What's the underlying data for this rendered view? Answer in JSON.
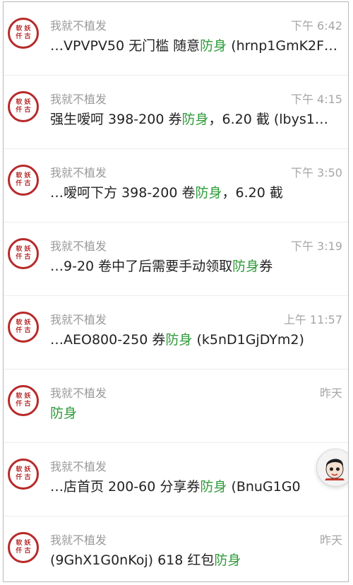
{
  "list": [
    {
      "sender": "我就不植发",
      "time": "下午 6:42",
      "pre": "…VPVPV50 无门槛 随意",
      "hl": "防身",
      "post": " (hrnp1GmK2F…"
    },
    {
      "sender": "我就不植发",
      "time": "下午 4:15",
      "pre": "强生嗳呵 398-200 券",
      "hl": "防身",
      "post": "，6.20 截  (lbys1…"
    },
    {
      "sender": "我就不植发",
      "time": "下午 3:50",
      "pre": "…嗳呵下方 398-200 卷",
      "hl": "防身",
      "post": "，6.20 截"
    },
    {
      "sender": "我就不植发",
      "time": "下午 3:19",
      "pre": "…9-20 卷中了后需要手动领取",
      "hl": "防身",
      "post": "券"
    },
    {
      "sender": "我就不植发",
      "time": "上午 11:57",
      "pre": "…AEO800-250 券",
      "hl": "防身",
      "post": "  (k5nD1GjDYm2)"
    },
    {
      "sender": "我就不植发",
      "time": "昨天",
      "pre": "",
      "hl": "防身",
      "post": ""
    },
    {
      "sender": "我就不植发",
      "time": "",
      "pre": "…店首页 200-60 分享券",
      "hl": "防身",
      "post": "  (BnuG1G0"
    },
    {
      "sender": "我就不植发",
      "time": "昨天",
      "pre": "(9GhX1G0nKoj)  618 红包",
      "hl": "防身",
      "post": ""
    }
  ],
  "avatar_seal": {
    "line1": "软 妖",
    "line2": "仟 古"
  },
  "colors": {
    "highlight": "#2f9b3a",
    "seal": "#b72a2a"
  }
}
